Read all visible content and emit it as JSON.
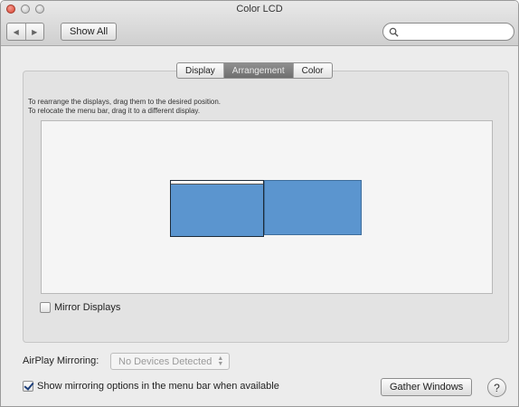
{
  "window": {
    "title": "Color LCD"
  },
  "toolbar": {
    "back_icon": "chevron-left-icon",
    "forward_icon": "chevron-right-icon",
    "show_all_label": "Show All",
    "search_value": "",
    "search_icon": "search-icon"
  },
  "tabs": [
    "Display",
    "Arrangement",
    "Color"
  ],
  "active_tab": "Arrangement",
  "instructions": {
    "line1": "To rearrange the displays, drag them to the desired position.",
    "line2": "To relocate the menu bar, drag it to a different display."
  },
  "displays": [
    {
      "role": "main",
      "has_menu_bar": true,
      "color": "#5b95cf"
    },
    {
      "role": "secondary",
      "has_menu_bar": false,
      "color": "#5b95cf"
    }
  ],
  "mirror_displays": {
    "label": "Mirror Displays",
    "checked": false
  },
  "airplay": {
    "label": "AirPlay Mirroring:",
    "selected": "No Devices Detected",
    "enabled": false
  },
  "show_mirroring": {
    "label": "Show mirroring options in the menu bar when available",
    "checked": true
  },
  "gather_windows_label": "Gather Windows",
  "help_label": "?"
}
